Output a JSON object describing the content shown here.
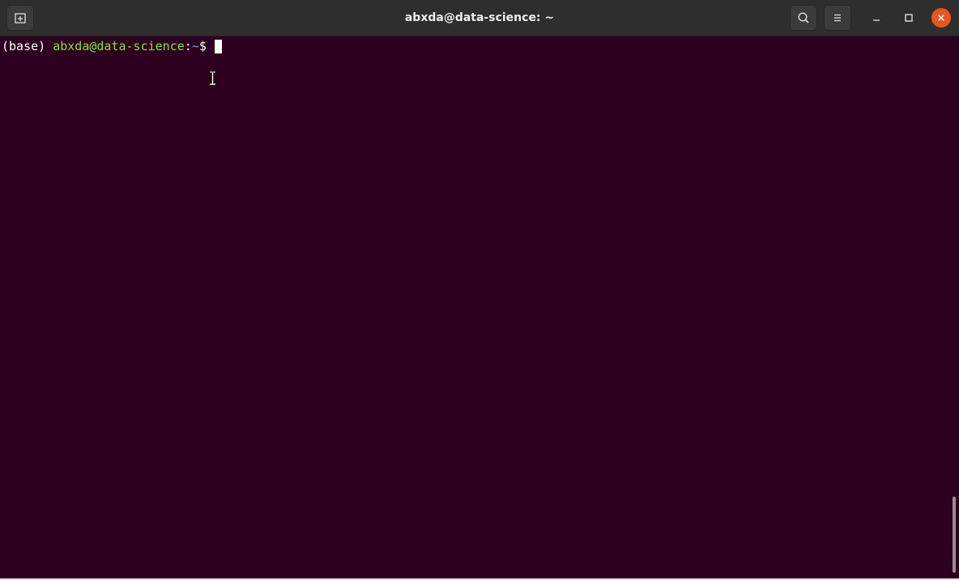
{
  "window": {
    "title": "abxda@data-science: ~"
  },
  "headerbar": {
    "new_tab_icon": "new-tab-icon",
    "search_icon": "search-icon",
    "menu_icon": "hamburger-menu-icon",
    "minimize_icon": "minimize-icon",
    "maximize_icon": "maximize-icon",
    "close_icon": "close-icon"
  },
  "terminal": {
    "env": "(base)",
    "userhost": "abxda@data-science",
    "colon": ":",
    "cwd": "~",
    "dollar": "$",
    "background": "#2c001e",
    "prompt_user_color": "#8ae234",
    "prompt_path_color": "#729fcf"
  },
  "colors": {
    "close_button": "#e95420",
    "headerbar": "#2e2e2e"
  }
}
